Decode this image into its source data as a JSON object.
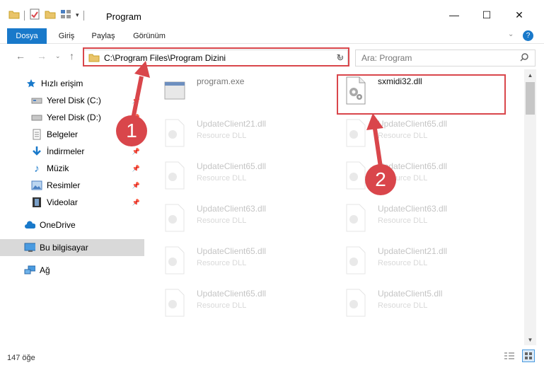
{
  "window": {
    "title": "Program"
  },
  "ribbon": {
    "tabs": [
      "Dosya",
      "Giriş",
      "Paylaş",
      "Görünüm"
    ]
  },
  "address": {
    "path": "C:\\Program Files\\Program Dizini"
  },
  "search": {
    "placeholder": "Ara: Program"
  },
  "sidebar": {
    "items": [
      {
        "label": "Hızlı erişim",
        "icon": "star-icon"
      },
      {
        "label": "Yerel Disk (C:)",
        "icon": "drive-icon"
      },
      {
        "label": "Yerel Disk (D:)",
        "icon": "drive-icon"
      },
      {
        "label": "Belgeler",
        "icon": "document-icon"
      },
      {
        "label": "İndirmeler",
        "icon": "download-icon"
      },
      {
        "label": "Müzik",
        "icon": "music-icon"
      },
      {
        "label": "Resimler",
        "icon": "picture-icon"
      },
      {
        "label": "Videolar",
        "icon": "video-icon"
      },
      {
        "label": "OneDrive",
        "icon": "cloud-icon"
      },
      {
        "label": "Bu bilgisayar",
        "icon": "computer-icon"
      },
      {
        "label": "Ağ",
        "icon": "network-icon"
      }
    ]
  },
  "files": [
    {
      "name": "program.exe",
      "desc": ""
    },
    {
      "name": "sxmidi32.dll",
      "desc": ""
    },
    {
      "name": "UpdateClient21.dll",
      "desc": "Resource DLL"
    },
    {
      "name": "UpdateClient65.dll",
      "desc": "Resource DLL"
    },
    {
      "name": "UpdateClient65.dll",
      "desc": "Resource DLL"
    },
    {
      "name": "UpdateClient65.dll",
      "desc": "Resource DLL"
    },
    {
      "name": "UpdateClient63.dll",
      "desc": "Resource DLL"
    },
    {
      "name": "UpdateClient63.dll",
      "desc": "Resource DLL"
    },
    {
      "name": "UpdateClient65.dll",
      "desc": "Resource DLL"
    },
    {
      "name": "UpdateClient21.dll",
      "desc": "Resource DLL"
    },
    {
      "name": "UpdateClient65.dll",
      "desc": "Resource DLL"
    },
    {
      "name": "UpdateClient5.dll",
      "desc": "Resource DLL"
    }
  ],
  "status": {
    "count": "147 öğe"
  },
  "annotations": {
    "badge1": "1",
    "badge2": "2"
  },
  "colors": {
    "accent": "#1979ca",
    "highlight": "#d9464b",
    "selected": "#d9d9d9"
  }
}
